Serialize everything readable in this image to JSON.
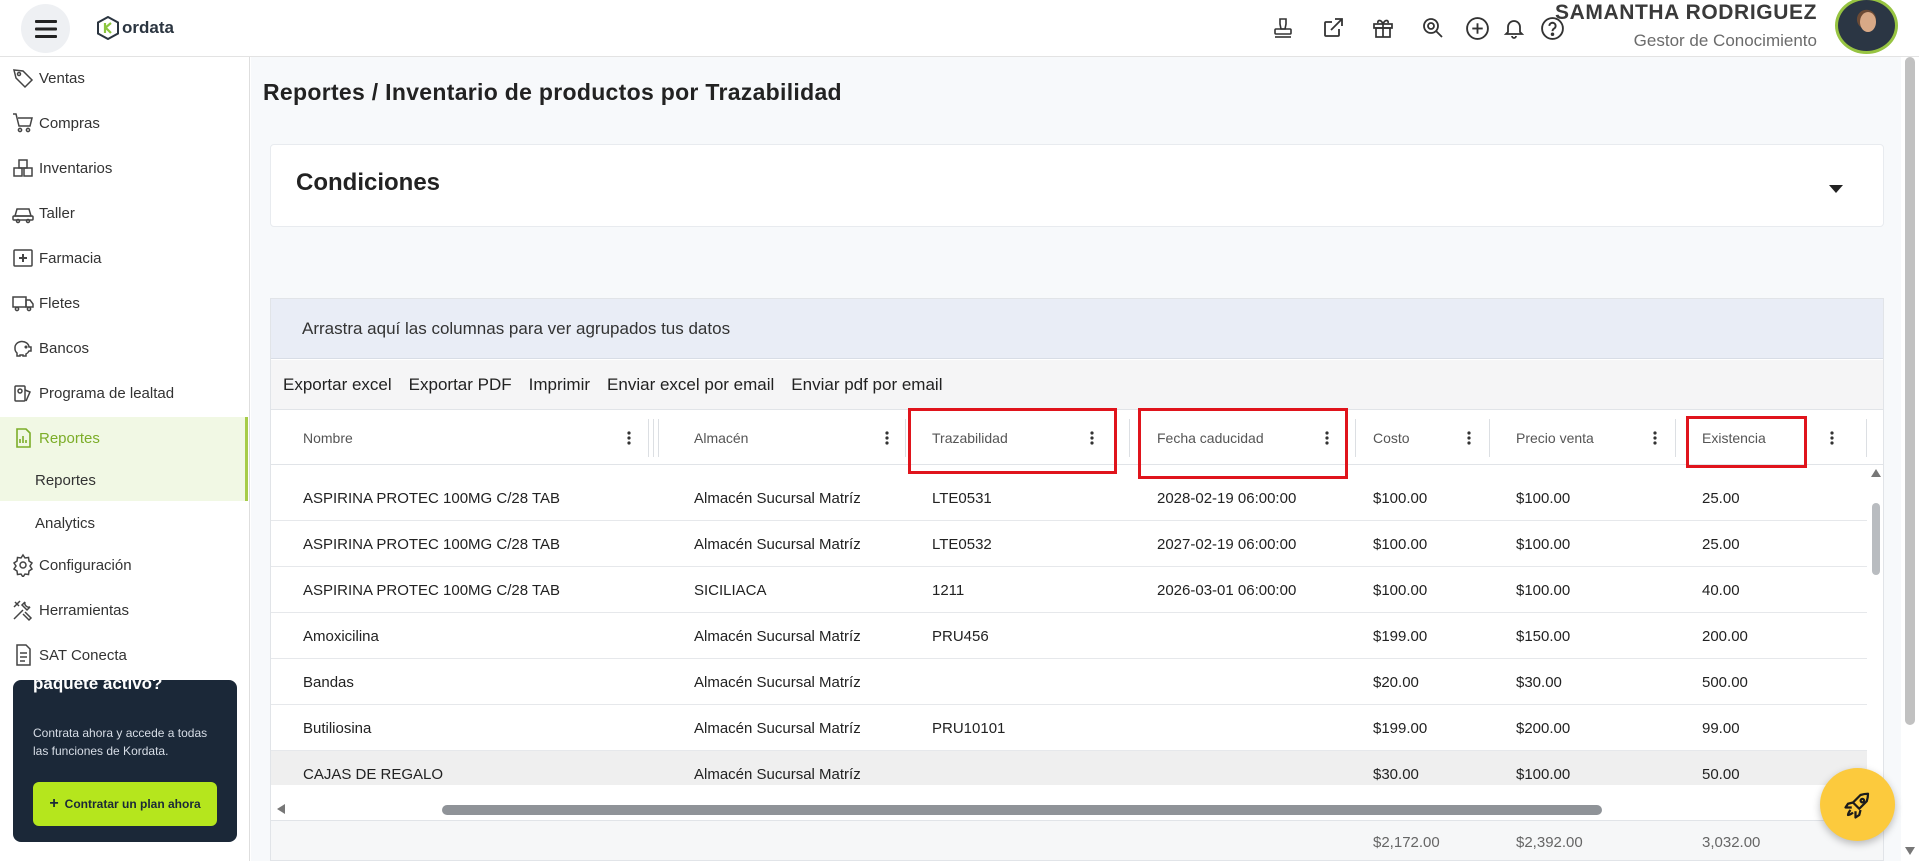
{
  "header": {
    "logo_text": "ordata",
    "user_name": "SAMANTHA RODRIGUEZ",
    "user_role": "Gestor de Conocimiento",
    "icons": [
      "stamp-icon",
      "external-link-icon",
      "gift-icon",
      "zoom-icon",
      "plus-circle-icon",
      "bell-icon",
      "help-icon"
    ]
  },
  "sidebar": {
    "items": [
      {
        "label": "Ventas",
        "icon": "sales-tag-icon"
      },
      {
        "label": "Compras",
        "icon": "cart-icon"
      },
      {
        "label": "Inventarios",
        "icon": "boxes-icon"
      },
      {
        "label": "Taller",
        "icon": "car-icon"
      },
      {
        "label": "Farmacia",
        "icon": "medical-cross-icon"
      },
      {
        "label": "Fletes",
        "icon": "truck-icon"
      },
      {
        "label": "Bancos",
        "icon": "piggy-bank-icon"
      },
      {
        "label": "Programa de lealtad",
        "icon": "loyalty-icon"
      },
      {
        "label": "Reportes",
        "icon": "report-icon",
        "active": true
      },
      {
        "label": "Configuración",
        "icon": "gear-icon"
      },
      {
        "label": "Herramientas",
        "icon": "tools-icon"
      },
      {
        "label": "SAT Conecta",
        "icon": "document-icon"
      }
    ],
    "sub_items": [
      {
        "label": "Reportes",
        "selected": true
      },
      {
        "label": "Analytics",
        "selected": false
      }
    ],
    "promo": {
      "title": "paquete activo?",
      "description": "Contrata ahora y accede a todas las funciones de Kordata.",
      "button_label": "Contratar un plan ahora"
    }
  },
  "main": {
    "breadcrumb": "Reportes /  Inventario de productos por Trazabilidad",
    "conditions_title": "Condiciones",
    "group_hint": "Arrastra aquí las columnas para ver agrupados tus datos",
    "toolbar": [
      "Exportar excel",
      "Exportar PDF",
      "Imprimir",
      "Enviar excel por email",
      "Enviar pdf por email"
    ],
    "columns": [
      "Nombre",
      "Almacén",
      "Trazabilidad",
      "Fecha caducidad",
      "Costo",
      "Precio venta",
      "Existencia"
    ],
    "rows": [
      [
        "ASPIRINA PROTEC 100MG C/28 TAB",
        "Almacén Sucursal Matríz",
        "LTE0531",
        "2028-02-19 06:00:00",
        "$100.00",
        "$100.00",
        "25.00"
      ],
      [
        "ASPIRINA PROTEC 100MG C/28 TAB",
        "Almacén Sucursal Matríz",
        "LTE0532",
        "2027-02-19 06:00:00",
        "$100.00",
        "$100.00",
        "25.00"
      ],
      [
        "ASPIRINA PROTEC 100MG C/28 TAB",
        "SICILIACA",
        "1211",
        "2026-03-01 06:00:00",
        "$100.00",
        "$100.00",
        "40.00"
      ],
      [
        "Amoxicilina",
        "Almacén Sucursal Matríz",
        "PRU456",
        "",
        "$199.00",
        "$150.00",
        "200.00"
      ],
      [
        "Bandas",
        "Almacén Sucursal Matríz",
        "",
        "",
        "$20.00",
        "$30.00",
        "500.00"
      ],
      [
        "Butiliosina",
        "Almacén Sucursal Matríz",
        "PRU10101",
        "",
        "$199.00",
        "$200.00",
        "99.00"
      ],
      [
        "CAJAS DE REGALO",
        "Almacén Sucursal Matríz",
        "",
        "",
        "$30.00",
        "$100.00",
        "50.00"
      ]
    ],
    "totals": {
      "costo": "$2,172.00",
      "precio_venta": "$2,392.00",
      "existencia": "3,032.00"
    },
    "highlight_color": "#e0141c",
    "accent_color": "#a6cc48"
  }
}
